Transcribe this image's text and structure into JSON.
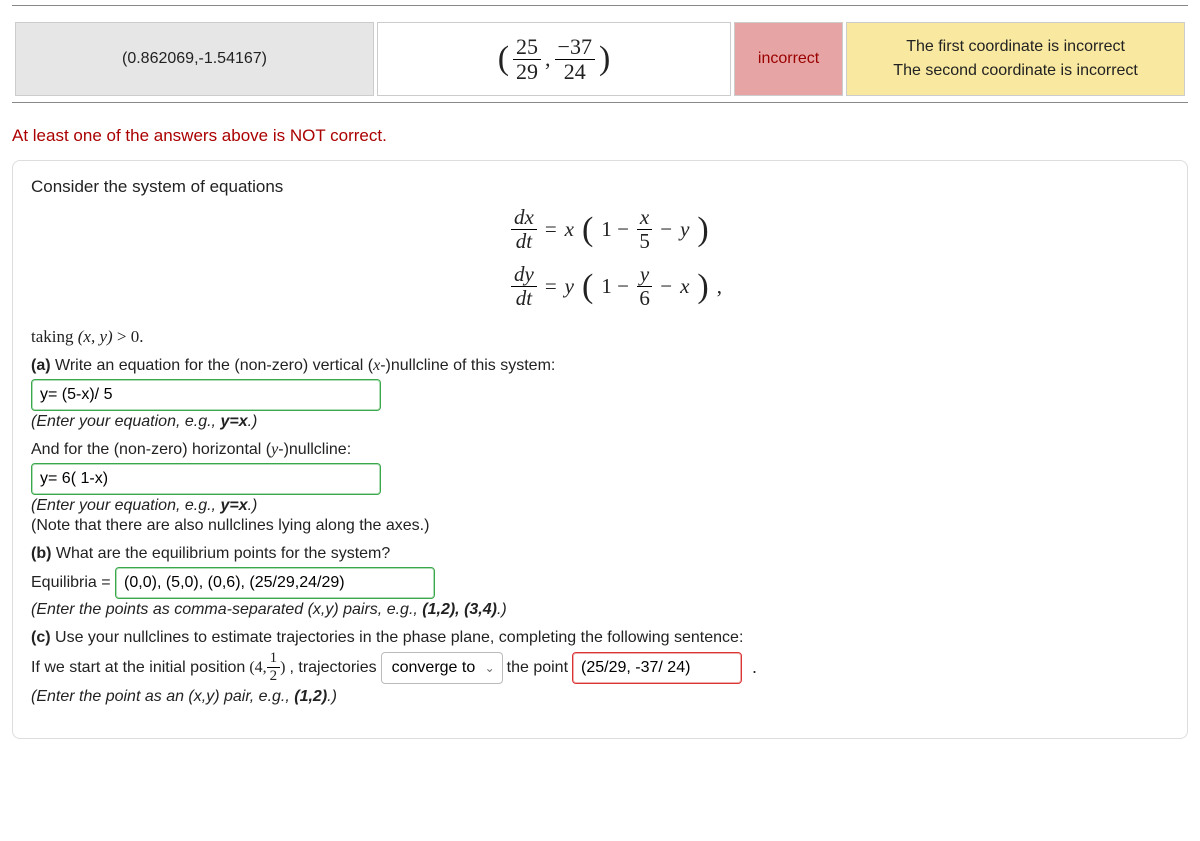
{
  "summary": {
    "entered": "(0.862069,-1.54167)",
    "preview_frac1_num": "25",
    "preview_frac1_den": "29",
    "preview_comma": ",",
    "preview_frac2_num": "−37",
    "preview_frac2_den": "24",
    "result": "incorrect",
    "messages_line1": "The first coordinate is incorrect",
    "messages_line2": "The second coordinate is incorrect"
  },
  "error_line": "At least one of the answers above is NOT correct.",
  "intro": "Consider the system of equations",
  "equations": {
    "eq1": {
      "d_num": "dx",
      "d_den": "dt",
      "eq": " = ",
      "var": "x",
      "one": "1 − ",
      "fnum": "x",
      "fden": "5",
      "minus": " − ",
      "tail": "y"
    },
    "eq2": {
      "d_num": "dy",
      "d_den": "dt",
      "eq": " = ",
      "var": "y",
      "one": "1 − ",
      "fnum": "y",
      "fden": "6",
      "minus": " − ",
      "tail": "x",
      "comma": ","
    }
  },
  "taking": "taking (x, y) > 0.",
  "parta": {
    "prompt": "(a) Write an equation for the (non-zero) vertical (x-)nullcline of this system:",
    "value": "y= (5-x)/ 5",
    "hint": "(Enter your equation, e.g., y=x.)"
  },
  "horiz": {
    "prompt": "And for the (non-zero) horizontal (y-)nullcline:",
    "value": "y= 6( 1-x)",
    "hint1": "(Enter your equation, e.g., y=x.)",
    "hint2": "(Note that there are also nullclines lying along the axes.)"
  },
  "partb": {
    "prompt": "(b) What are the equilibrium points for the system?",
    "label": "Equilibria = ",
    "value": "(0,0), (5,0), (0,6), (25/29,24/29)",
    "hint": "(Enter the points as comma-separated (x,y) pairs, e.g., (1,2), (3,4).)"
  },
  "partc": {
    "prompt": "(c) Use your nullclines to estimate trajectories in the phase plane, completing the following sentence:",
    "line_prefix": "If we start at the initial position ",
    "pos_open": "(4, ",
    "pos_frac_num": "1",
    "pos_frac_den": "2",
    "pos_close": ")",
    "line_mid": ", trajectories ",
    "select_value": "converge to",
    "line_after_select": " the point ",
    "point_value": "(25/29, -37/ 24)",
    "hint": "(Enter the point as an (x,y) pair, e.g., (1,2).)",
    "period": "."
  }
}
